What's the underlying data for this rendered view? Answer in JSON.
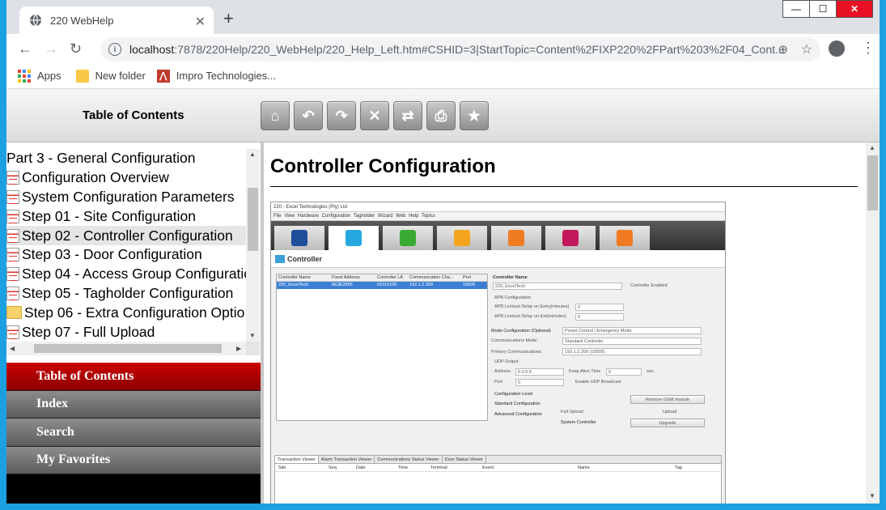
{
  "browser": {
    "tab_title": "220 WebHelp",
    "tab_close": "✕",
    "new_tab": "+",
    "url_host": "localhost",
    "url_rest": ":7878/220Help/220_WebHelp/220_Help_Left.htm#CSHID=3|StartTopic=Content%2FIXP220%2FPart%203%2F04_Cont...",
    "window_controls": {
      "minimize": "—",
      "maximize": "☐",
      "close": "✕"
    }
  },
  "bookmarks": [
    {
      "label": "Apps",
      "icon": "apps-grid-icon"
    },
    {
      "label": "New folder",
      "icon": "folder-icon"
    },
    {
      "label": "Impro Technologies...",
      "icon": "impro-logo-icon"
    }
  ],
  "webhelp": {
    "header_title": "Table of Contents",
    "toolbar": [
      {
        "name": "home-button",
        "glyph": "⌂"
      },
      {
        "name": "back-button",
        "glyph": "↶"
      },
      {
        "name": "forward-button",
        "glyph": "↷"
      },
      {
        "name": "stop-button",
        "glyph": "✕"
      },
      {
        "name": "refresh-button",
        "glyph": "⇄"
      },
      {
        "name": "print-button",
        "glyph": "⎙"
      },
      {
        "name": "add-favorite-button",
        "glyph": "★"
      }
    ],
    "toc": [
      {
        "label": "Part 3 - General Configuration",
        "icon": "none"
      },
      {
        "label": "Configuration Overview",
        "icon": "page"
      },
      {
        "label": "System Configuration Parameters",
        "icon": "page"
      },
      {
        "label": "Step 01 - Site Configuration",
        "icon": "page"
      },
      {
        "label": "Step 02 - Controller Configuration",
        "icon": "page",
        "selected": true
      },
      {
        "label": "Step 03 - Door Configuration",
        "icon": "page"
      },
      {
        "label": "Step 04 - Access Group Configuratio",
        "icon": "page"
      },
      {
        "label": "Step 05 - Tagholder Configuration",
        "icon": "page"
      },
      {
        "label": "Step 06 - Extra Configuration Optio",
        "icon": "folder"
      },
      {
        "label": "Step 07 - Full Upload",
        "icon": "page"
      }
    ],
    "nav_tabs": [
      {
        "label": "Table of Contents",
        "active": true
      },
      {
        "label": "Index",
        "active": false
      },
      {
        "label": "Search",
        "active": false
      },
      {
        "label": "My Favorites",
        "active": false
      }
    ],
    "content_title": "Controller Configuration"
  },
  "embedded_screenshot": {
    "title": "220 - Excel Technologies (Pty) Ltd",
    "menu": "File  View  Hardware  Configuration  Tagholder  Wizard  Web  Help Topics",
    "tile_colors": [
      "#1f4e9b",
      "#26a9e0",
      "#3aaa35",
      "#f4a41c",
      "#f07b22",
      "#c2185b",
      "#f07b22"
    ],
    "section": "Controller",
    "grid_headers": [
      "Controller Name",
      "Fixed Address",
      "Controller LA",
      "Communication Cha...",
      "Port"
    ],
    "grid_row": [
      "220_ExcelTech",
      "6E3E2896",
      "01010100",
      "192.1.2.209",
      "10005"
    ],
    "form": {
      "controller_name_label": "Controller Name",
      "controller_name": "220_ExcelTech",
      "controller_enabled": "Controller Enabled",
      "apb_config": "APB Configuration",
      "apb_entry": "APB Lockout Delay on Entry(minutes)",
      "apb_exit": "APB Lockout Delay on Exit(minutes)",
      "zero": "0",
      "mode_config": "Mode Configuration (Optional)",
      "mode_value": "Power Control / Emergency Mode",
      "comm_mode_label": "Communications Mode:",
      "comm_mode": "Standard Controller",
      "primary_label": "Primary Communications:",
      "primary": "192.1.2.209 (10005)",
      "udp_output": "UDP Output",
      "address_label": "Address",
      "address": "0.0.0.0",
      "keep_alive": "Keep Alive Time",
      "sec": "sec.",
      "port_label": "Port",
      "enable_udp": "Enable UDP Broadcast",
      "config_level": "Configuration Level",
      "standard": "Standard Configuration",
      "advanced": "Advanced Configuration",
      "remove_gsm": "Remove GSM module",
      "full_upload": "Full Upload",
      "upload": "Upload",
      "system_controller": "System Controller",
      "upgrade": "Upgrade"
    },
    "bottom_tabs": [
      "Transaction Viewer",
      "Alarm Transaction Viewer",
      "Communications Status Viewer",
      "Door Status Viewer"
    ],
    "bottom_cols": [
      "Site",
      "Seq",
      "Date",
      "Time",
      "Terminal",
      "Event",
      "Name",
      "Tag"
    ]
  }
}
